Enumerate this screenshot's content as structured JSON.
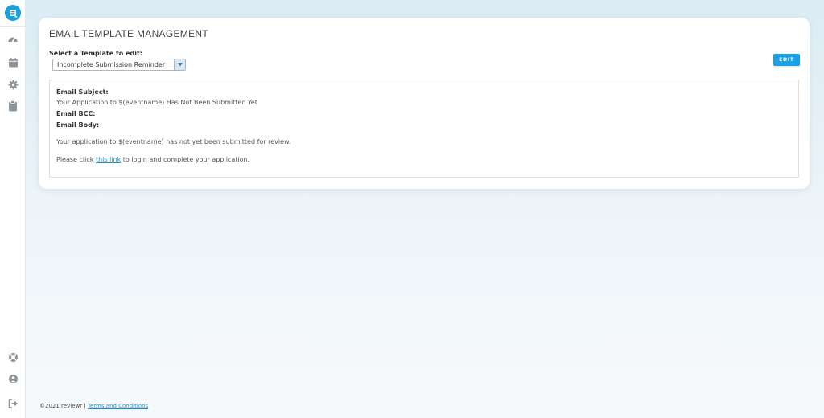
{
  "colors": {
    "accent": "#1aa0e6",
    "sidebar_icon": "#8d959c",
    "link": "#1a8fd6",
    "page_bg_top": "#dcecf4"
  },
  "sidebar": {
    "logo_icon": "reviewr-logo-icon",
    "items": [
      {
        "icon": "dashboard-icon"
      },
      {
        "icon": "calendar-icon"
      },
      {
        "icon": "settings-gear-icon"
      },
      {
        "icon": "clipboard-icon"
      }
    ],
    "bottom_items": [
      {
        "icon": "help-lifebuoy-icon"
      },
      {
        "icon": "user-account-icon"
      },
      {
        "icon": "logout-icon"
      }
    ]
  },
  "card": {
    "title": "EMAIL TEMPLATE MANAGEMENT",
    "select_label": "Select a Template to edit:",
    "select_value": "Incomplete Submission Reminder",
    "edit_label": "EDIT"
  },
  "preview": {
    "subject_label": "Email Subject:",
    "subject_value": "Your Application to $(eventname) Has Not Been Submitted Yet",
    "bcc_label": "Email BCC:",
    "body_label": "Email Body:",
    "body_para1": "Your application to $(eventname) has not yet been submitted for review.",
    "body_para2_before": "Please click",
    "body_para2_link": "this link",
    "body_para2_after": "to login and complete your application."
  },
  "footer": {
    "copyright": "©2021 reviewr |",
    "terms_link": "Terms and Conditions"
  }
}
